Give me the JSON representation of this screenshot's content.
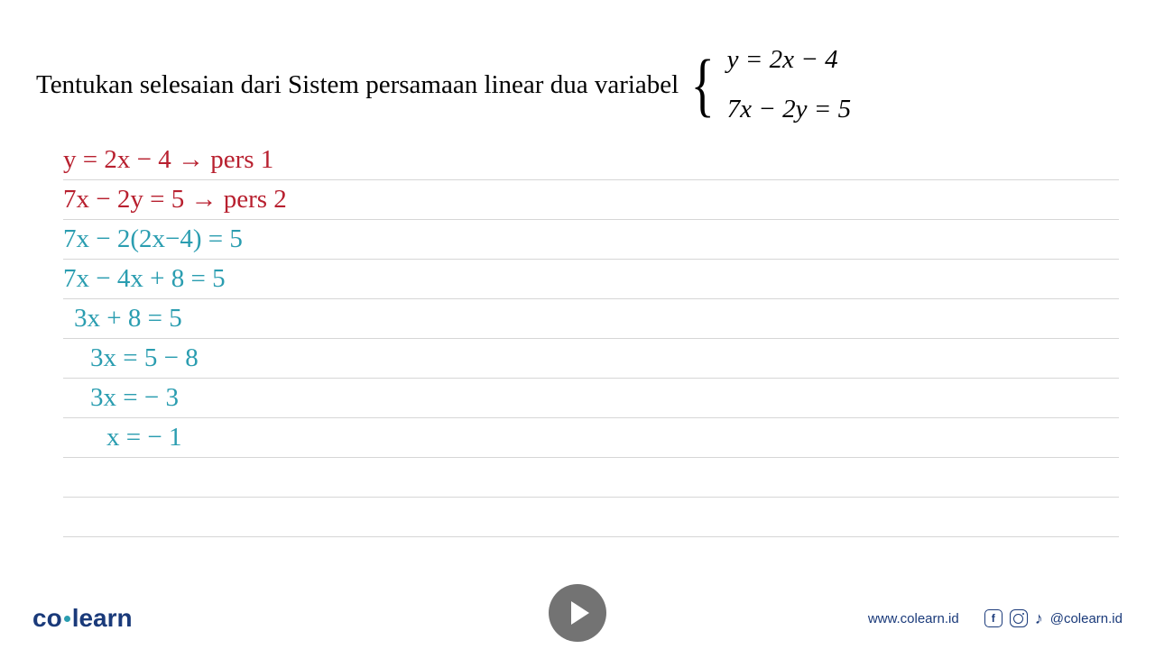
{
  "question": {
    "text": "Tentukan selesaian dari Sistem persamaan linear dua variabel",
    "eq1_lhs": "y",
    "eq1_rhs": "2x − 4",
    "eq2_lhs": "7x − 2y",
    "eq2_rhs": "5"
  },
  "work": {
    "l1": "y = 2x − 4   → pers 1",
    "l2": "7x − 2y = 5  → pers 2",
    "l3": "7x − 2(2x−4) = 5",
    "l4": "7x − 4x + 8 = 5",
    "l5": "3x + 8 = 5",
    "l6": "3x    = 5 − 8",
    "l7": "3x   = − 3",
    "l8": "x  =  − 1"
  },
  "footer": {
    "logo_co": "co",
    "logo_learn": "learn",
    "url": "www.colearn.id",
    "handle": "@colearn.id"
  }
}
